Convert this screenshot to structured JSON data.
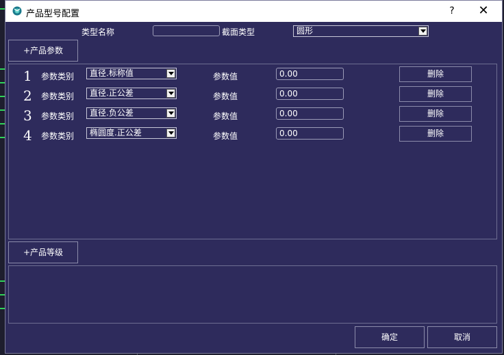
{
  "window": {
    "title": "产品型号配置",
    "help": "?",
    "close": "✕"
  },
  "form": {
    "type_name_label": "类型名称",
    "type_name_value": "",
    "section_type_label": "截面类型",
    "section_type_value": "圆形"
  },
  "params": {
    "add_label": "+产品参数",
    "rows": [
      {
        "num": "1",
        "category_label": "参数类别",
        "category": "直径.标称值",
        "value_label": "参数值",
        "value": "0.00",
        "delete": "删除"
      },
      {
        "num": "2",
        "category_label": "参数类别",
        "category": "直径.正公差",
        "value_label": "参数值",
        "value": "0.00",
        "delete": "删除"
      },
      {
        "num": "3",
        "category_label": "参数类别",
        "category": "直径.负公差",
        "value_label": "参数值",
        "value": "0.00",
        "delete": "删除"
      },
      {
        "num": "4",
        "category_label": "参数类别",
        "category": "椭圆度.正公差",
        "value_label": "参数值",
        "value": "0.00",
        "delete": "删除"
      }
    ]
  },
  "grades": {
    "add_label": "+产品等级"
  },
  "footer": {
    "ok": "确定",
    "cancel": "取消"
  },
  "colors": {
    "window_bg": "#2e2b5c",
    "titlebar_bg": "#ffffff",
    "outer_bg": "#1e1e2e",
    "accent_green": "#2fd35a"
  }
}
